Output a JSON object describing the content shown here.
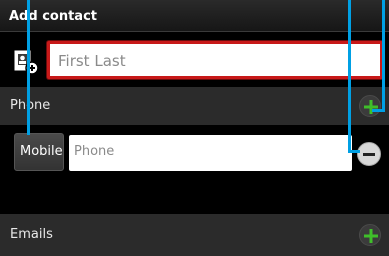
{
  "header": {
    "title": "Add contact"
  },
  "name": {
    "placeholder": "First Last"
  },
  "phone_section": {
    "label": "Phone"
  },
  "phone_entry": {
    "type_label": "Mobile",
    "placeholder": "Phone"
  },
  "emails_section": {
    "label": "Emails"
  },
  "icons": {
    "contact": "contact-card-icon",
    "add": "plus-icon",
    "remove": "minus-icon"
  },
  "colors": {
    "accent_green": "#3fbf2a",
    "focus_red": "#c81919",
    "callout_blue": "#00a0e4"
  }
}
